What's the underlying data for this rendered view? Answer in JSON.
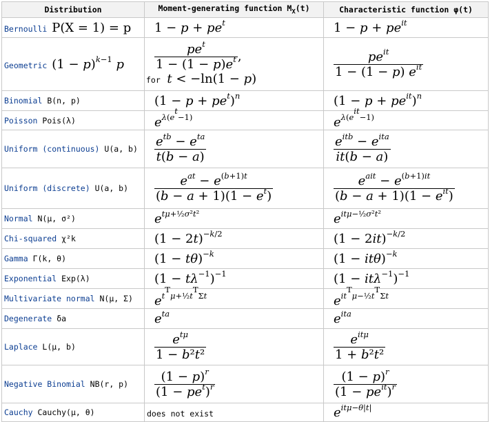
{
  "headers": {
    "distribution": "Distribution",
    "mgf": "Moment-generating function M",
    "mgf_sub": "X",
    "mgf_arg": "(t)",
    "cf": "Characteristic function φ(t)"
  },
  "rows": [
    {
      "name": "Bernoulli",
      "param": "P(X = 1) = p",
      "mgf_note": ""
    },
    {
      "name": "Geometric",
      "param": "(1 − p)^(k−1) p",
      "mgf_note": "for",
      "mgf_cond": "t < −ln(1 − p)"
    },
    {
      "name": "Binomial",
      "param": "B(n, p)"
    },
    {
      "name": "Poisson",
      "param": "Pois(λ)"
    },
    {
      "name": "Uniform (continuous)",
      "param": "U(a, b)"
    },
    {
      "name": "Uniform (discrete)",
      "param": "U(a, b)"
    },
    {
      "name": "Normal",
      "param": "N(μ, σ²)"
    },
    {
      "name": "Chi-squared",
      "param": "χ²k"
    },
    {
      "name": "Gamma",
      "param": "Γ(k, θ)"
    },
    {
      "name": "Exponential",
      "param": "Exp(λ)"
    },
    {
      "name": "Multivariate normal",
      "param": "N(μ, Σ)"
    },
    {
      "name": "Degenerate",
      "param": "δa"
    },
    {
      "name": "Laplace",
      "param": "L(μ, b)"
    },
    {
      "name": "Negative Binomial",
      "param": "NB(r, p)"
    },
    {
      "name": "Cauchy",
      "param": "Cauchy(μ, θ)",
      "mgf_text": "does not exist"
    }
  ]
}
